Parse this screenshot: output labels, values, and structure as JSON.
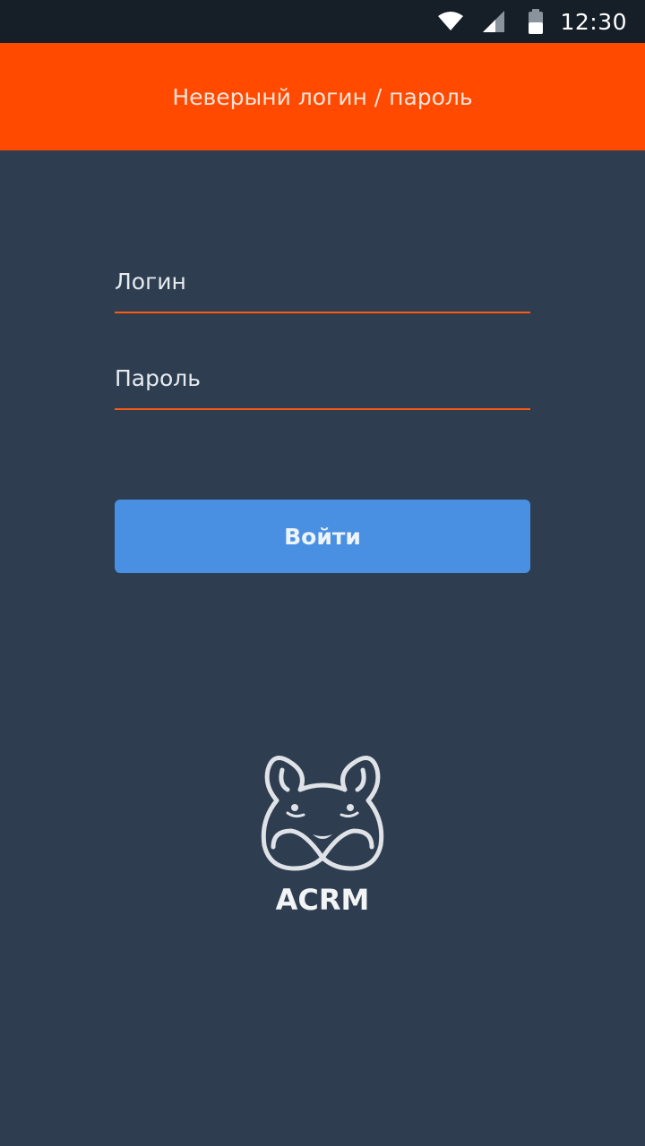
{
  "status_bar": {
    "time": "12:30",
    "icons": [
      "wifi-icon",
      "signal-icon",
      "battery-icon"
    ]
  },
  "error_banner": {
    "message": "Неверынй логин / пароль",
    "color": "#ff4a00"
  },
  "form": {
    "login": {
      "placeholder": "Логин",
      "value": ""
    },
    "password": {
      "placeholder": "Пароль",
      "value": ""
    },
    "submit_label": "Войти"
  },
  "branding": {
    "logo_icon": "hamster-logo-icon",
    "app_name": "ACRM"
  },
  "colors": {
    "background": "#2e3d50",
    "accent_underline": "#ff5a10",
    "button": "#4a90e2",
    "status_bar": "#161e28"
  }
}
